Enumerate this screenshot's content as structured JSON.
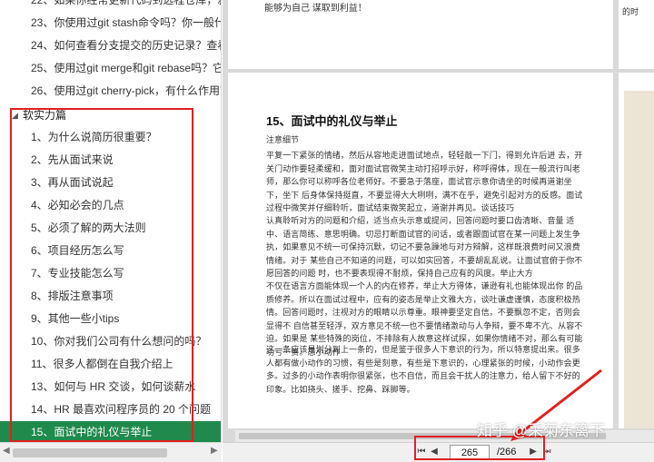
{
  "sidebar": {
    "items_top": [
      {
        "label": "23、你使用过git stash命令吗？你一般什么..."
      },
      {
        "label": "24、如何查看分支提交的历史记录？查看某..."
      },
      {
        "label": "25、使用过git merge和git rebase吗？它..."
      },
      {
        "label": "26、使用过git cherry-pick，有什么作用？"
      }
    ],
    "partial_top": "22、如果你经常更新代码到远程仓库，就合...",
    "section": {
      "title": "软实力篇"
    },
    "items": [
      {
        "label": "1、为什么说简历很重要？"
      },
      {
        "label": "2、先从面试来说"
      },
      {
        "label": "3、再从面试说起"
      },
      {
        "label": "4、必知必会的几点"
      },
      {
        "label": "5、必须了解的两大法则"
      },
      {
        "label": "6、项目经历怎么写"
      },
      {
        "label": "7、专业技能怎么写"
      },
      {
        "label": "8、排版注意事项"
      },
      {
        "label": "9、其他一些小tips"
      },
      {
        "label": "10、你对我们公司有什么想问的吗？"
      },
      {
        "label": "11、很多人都倒在自我介绍上"
      },
      {
        "label": "13、如何与 HR 交谈，如何谈薪水"
      },
      {
        "label": "14、HR 最喜欢问程序员的 20 个问题"
      },
      {
        "label": "15、面试中的礼仪与举止"
      }
    ]
  },
  "doc": {
    "prev_tail": "能够为自己 谋取到利益！",
    "side_fragment": "的时",
    "title": "15、面试中的礼仪与举止",
    "subtitle": "注意细节",
    "paragraphs": [
      "平复一下紧张的情绪，然后从容地走进面试地点，轻轻敲一下门，得到允许后进 去，开关门动作要轻柔缓和，面对面试官微笑主动打招呼示好，称呼得体，现在一般流行叫老 师，那么你可以称呼各位老师好。不要急于落座，面试官示意你请坐的时候再道谢坐下，坐下 后身体保持挺直，不要显得大大咧咧，满不在乎，避免引起对方的反感。面试过程中微笑并仔细聆听，面试结束微笑起立，道谢并再见。谈话技巧",
      "认真聆听对方的问题和介绍，适当点头示意或提问，回答问题时要口齿清晰、音量 适中、语言简练、意思明确。切忌打断面试官的问话，或者跟面试官在某一问题上发生争执，如果意见不统一可保持沉默，切记不要急躁地与对方辩解，这样既浪费时间又浪费情绪。对于 某些自己不知道的问题，可以如实回答，不要胡乱乱说。让面试官俯于你不愿回答的问题 时，也不要表现得不耐烦，保持自己应有的风度。举止大方",
      "不仅在语言方面能体现一个人的内在修养，举止大方得体，谦逊有礼也能体现出你 的品质修养。所以在面试过程中，应有的姿态是举止文雅大方，谈吐谦虚谨慎，态度积极热 情。回答问题时，注视对方的眼睛以示尊重。眼神要坚定自信，不要飘忽不定，否则会显得不 自信甚至轻浮，双方意见不统一也不要情绪激动与人争辩，要不卑不亢、从容不迫。如果是 某些特殊的岗位，不排除有人故意这样试探，如果你情绪不对，那么有可能功亏一篑。忌小动作",
      "这一条应该是划分到上一条的，但是鉴于很多人下意识的行为，所以特意提出来。很多人都有做小动作的习惯，有些是刻意，有些是下意识的，心理紧张的时候，小动作会更 多。过多的小动作表明你很紧张，也不自信，而且会干扰人的注意力，给人留下不好的印象。比如挠头、搓手、挖鼻、踩脚等。"
    ]
  },
  "navigation": {
    "current_page": "265",
    "total_pages": "/266",
    "first_icon": "first-page-icon",
    "prev_icon": "prev-page-icon",
    "next_icon": "next-page-icon",
    "last_icon": "last-page-icon"
  },
  "watermark": "知乎 @采菊东篱下",
  "colors": {
    "active_item": "#1f8a4c",
    "annotation": "#e02020",
    "viewer_bg": "#d9d9d9"
  }
}
